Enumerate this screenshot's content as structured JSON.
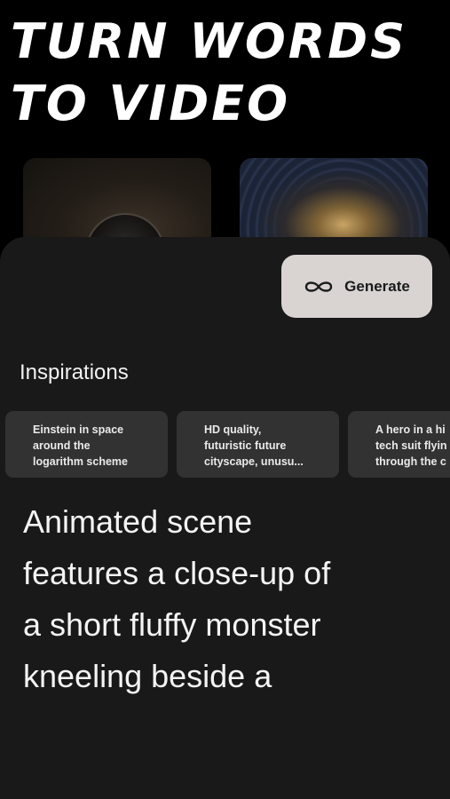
{
  "header": {
    "headline_line1": "TURN WORDS",
    "headline_line2": "TO VIDEO"
  },
  "previews": [
    {
      "name": "monster-preview"
    },
    {
      "name": "cosmic-tunnel-preview"
    }
  ],
  "generate": {
    "label": "Generate",
    "icon": "infinity-icon"
  },
  "inspirations": {
    "title": "Inspirations",
    "items": [
      {
        "lines": [
          "Einstein in space",
          "around the",
          "logarithm scheme"
        ]
      },
      {
        "lines": [
          "HD quality,",
          "futuristic future",
          "cityscape, unusu..."
        ]
      },
      {
        "lines": [
          "A hero in a hi",
          "tech suit flyin",
          "through the c"
        ]
      }
    ]
  },
  "prompt": {
    "lines": [
      "Animated scene",
      "features a close-up of",
      "a short fluffy monster",
      "kneeling beside a"
    ]
  },
  "colors": {
    "background": "#000000",
    "sheet": "#1a1919",
    "button": "#d9d4d2",
    "chip": "#333232",
    "text": "#ffffff"
  }
}
